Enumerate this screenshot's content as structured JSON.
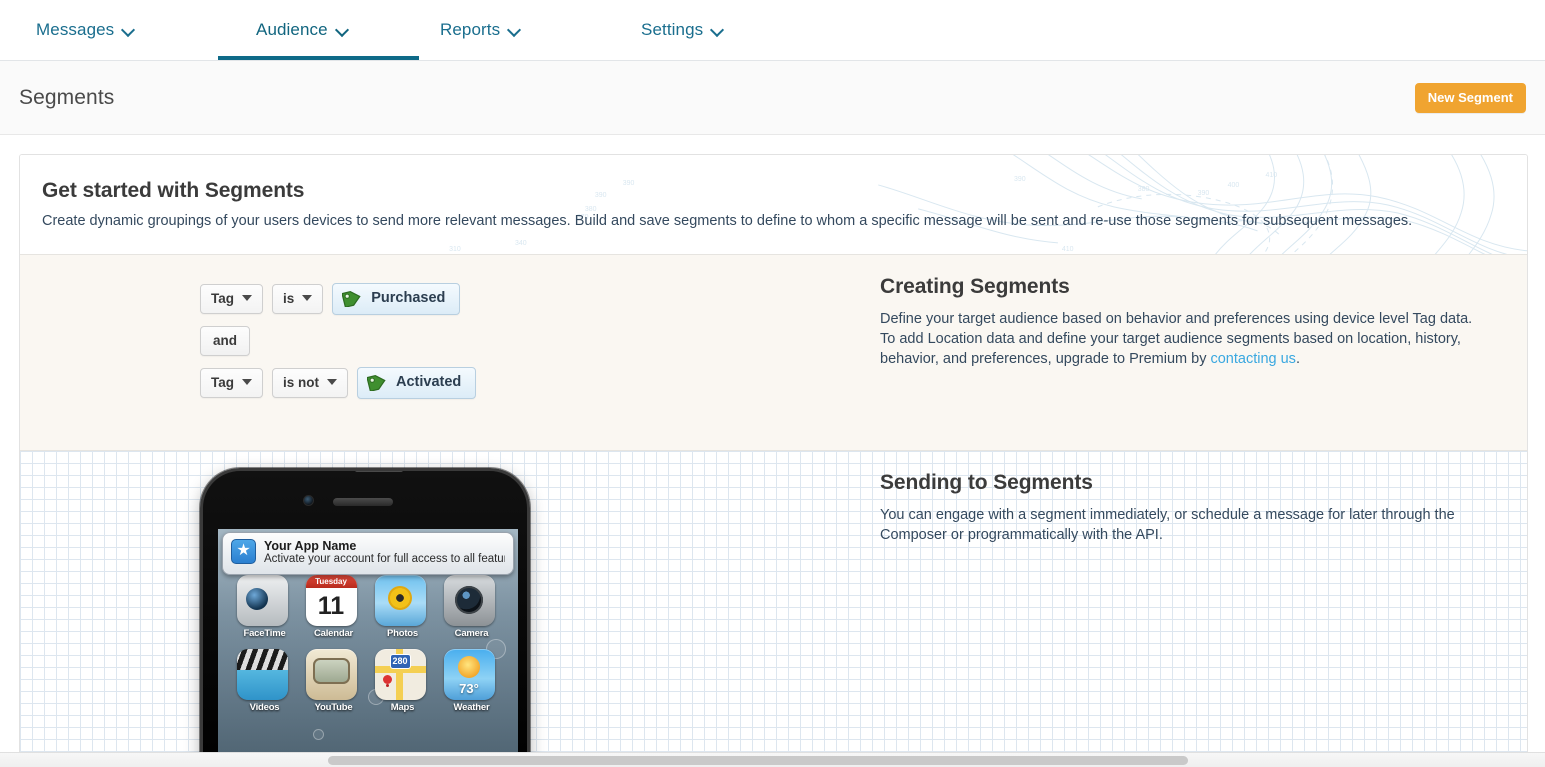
{
  "nav": {
    "items": [
      {
        "label": "Messages",
        "icon": "chevron-down-icon",
        "active": false
      },
      {
        "label": "Audience",
        "icon": "chevron-down-icon",
        "active": true
      },
      {
        "label": "Reports",
        "icon": "chevron-down-icon",
        "active": false
      },
      {
        "label": "Settings",
        "icon": "chevron-down-icon",
        "active": false
      }
    ],
    "active_color": "#0e6a88",
    "link_color": "#1a6e8e"
  },
  "page": {
    "title": "Segments",
    "new_segment_button": "New Segment",
    "accent_color": "#f0a430"
  },
  "intro": {
    "heading": "Get started with Segments",
    "body": "Create dynamic groupings of your users devices to send more relevant messages. Build and save segments to define to whom a specific message will be sent and re-use those segments for subsequent messages."
  },
  "creating": {
    "heading": "Creating Segments",
    "body_before_link": "Define your target audience based on behavior and preferences using device level Tag data. To add Location data and define your target audience segments based on location, history, behavior, and preferences, upgrade to Premium by ",
    "link_text": "contacting us",
    "body_after_link": ".",
    "link_color": "#3aa8e0",
    "builder": {
      "row1": {
        "field_label": "Tag",
        "operator_label": "is",
        "value_label": "Purchased",
        "value_icon": "tag-icon"
      },
      "conjunction": "and",
      "row2": {
        "field_label": "Tag",
        "operator_label": "is not",
        "value_label": "Activated",
        "value_icon": "tag-icon"
      }
    }
  },
  "sending": {
    "heading": "Sending to Segments",
    "body": "You can engage with a segment immediately, or schedule a message for later through the Composer or programmatically with the API."
  },
  "phone_mock": {
    "notification": {
      "app_name": "Your App Name",
      "message": "Activate your account for full access to all features…",
      "icon": "star-app-icon"
    },
    "apps": [
      {
        "label": "FaceTime",
        "icon": "facetime-icon"
      },
      {
        "label": "Calendar",
        "icon": "calendar-icon",
        "weekday": "Tuesday",
        "day": "11"
      },
      {
        "label": "Photos",
        "icon": "photos-icon"
      },
      {
        "label": "Camera",
        "icon": "camera-icon"
      },
      {
        "label": "Videos",
        "icon": "videos-icon"
      },
      {
        "label": "YouTube",
        "icon": "youtube-icon"
      },
      {
        "label": "Maps",
        "icon": "maps-icon",
        "badge": "280"
      },
      {
        "label": "Weather",
        "icon": "weather-icon",
        "temperature": "73°"
      }
    ]
  }
}
